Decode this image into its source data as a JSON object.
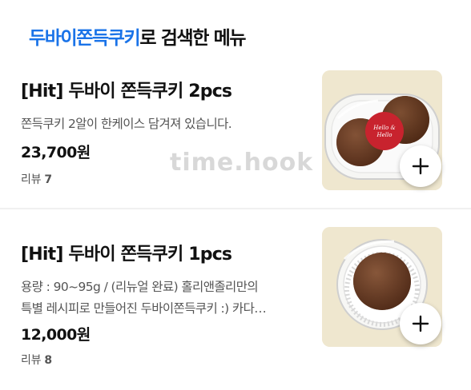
{
  "search": {
    "keyword": "두바이쫀득쿠키",
    "suffix": "로 검색한 메뉴"
  },
  "items": [
    {
      "name": "[Hit] 두바이 쫀득쿠키 2pcs",
      "description": [
        "쫀득쿠키 2알이 한케이스 담겨져 있습니다."
      ],
      "price": "23,700원",
      "review_label": "리뷰",
      "review_count": "7",
      "image_icon": "cookie-box-two-icon",
      "sticker_text": "Hello & Hello"
    },
    {
      "name": "[Hit] 두바이 쫀득쿠키 1pcs",
      "description": [
        "용량 : 90~95g / (리뉴얼 완료) 홀리앤졸리만의",
        "특별 레시피로 만들어진 두바이쫀득쿠키 :) 카다…"
      ],
      "price": "12,000원",
      "review_label": "리뷰",
      "review_count": "8",
      "image_icon": "cookie-box-one-icon"
    }
  ],
  "watermark": "time.hook",
  "colors": {
    "keyword": "#1a73e8",
    "thumb_bg": "#efe7cf",
    "cookie": "#6b3a22"
  }
}
